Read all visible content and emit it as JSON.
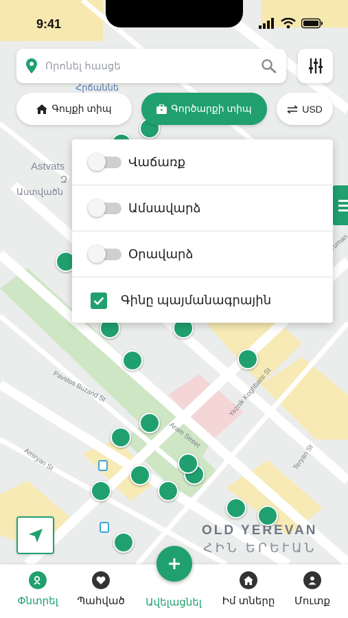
{
  "status_bar": {
    "time": "9:41"
  },
  "search": {
    "placeholder": "Որոնել հասցե"
  },
  "chips": {
    "home_type": "Գույքի տիպ",
    "commercial_type": "Գործարքի տիպ",
    "currency": "USD"
  },
  "dropdown": {
    "items": [
      {
        "label": "Վաճառք",
        "kind": "toggle",
        "on": false
      },
      {
        "label": "Ամսավարձ",
        "kind": "toggle",
        "on": false
      },
      {
        "label": "Օրավարձ",
        "kind": "toggle",
        "on": false
      },
      {
        "label": "Գինը պայմանագրային",
        "kind": "checkbox",
        "checked": true
      }
    ]
  },
  "map": {
    "labels": {
      "astvats": "Astvats",
      "astvats_arm": "Աստվածն",
      "yerevan_arm_top": "Հրճաննե",
      "old_yerevan": "OLD YEREVAN",
      "old_yerevan_arm": "ՀԻՆ ԵՐԵՒԱՆ",
      "zoomed_partial": "Զ"
    },
    "streets": {
      "pavstos": "Pavstos Buzand St",
      "aram": "Aram Street",
      "yeznik": "Yeznik Koghbatsi St",
      "amiryan": "Amiryan St",
      "teryan": "Teryan St",
      "tuman": "Tuman"
    }
  },
  "bottom_nav": {
    "items": [
      {
        "label": "Փնտրել",
        "icon": "search-home-icon",
        "active": true
      },
      {
        "label": "Պահված",
        "icon": "heart-icon",
        "active": false
      },
      {
        "label": "Ավելացնել",
        "icon": "plus-icon",
        "active": false
      },
      {
        "label": "Իմ տները",
        "icon": "home-icon",
        "active": false
      },
      {
        "label": "Մուտք",
        "icon": "user-icon",
        "active": false
      }
    ]
  },
  "colors": {
    "accent": "#21a06f",
    "map_bg": "#ebedec"
  }
}
